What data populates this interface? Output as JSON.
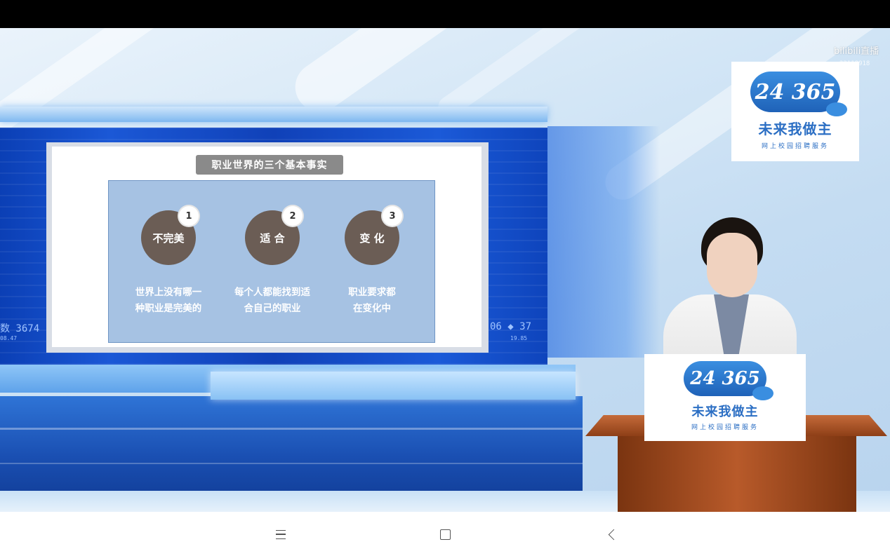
{
  "video": {
    "watermark": "bilibili直播",
    "watermark_id": "22118918",
    "ticker_left": "数 3674",
    "ticker_left_small": "08.47",
    "ticker_right": "06 ◆ 37",
    "ticker_right_small": "19.85"
  },
  "slide": {
    "title": "职业世界的三个基本事实",
    "facts": [
      {
        "num": "1",
        "label": "不完美",
        "desc": "世界上没有哪一\n种职业是完美的"
      },
      {
        "num": "2",
        "label": "适 合",
        "desc": "每个人都能找到适\n合自己的职业"
      },
      {
        "num": "3",
        "label": "变 化",
        "desc": "职业要求都\n在变化中"
      }
    ]
  },
  "logo": {
    "number": "24 365",
    "main": "未来我做主",
    "sub": "网上校园招聘服务"
  },
  "navbar": {
    "menu_icon": "menu-icon",
    "home_icon": "square-home-icon",
    "back_icon": "chevron-left-icon"
  }
}
